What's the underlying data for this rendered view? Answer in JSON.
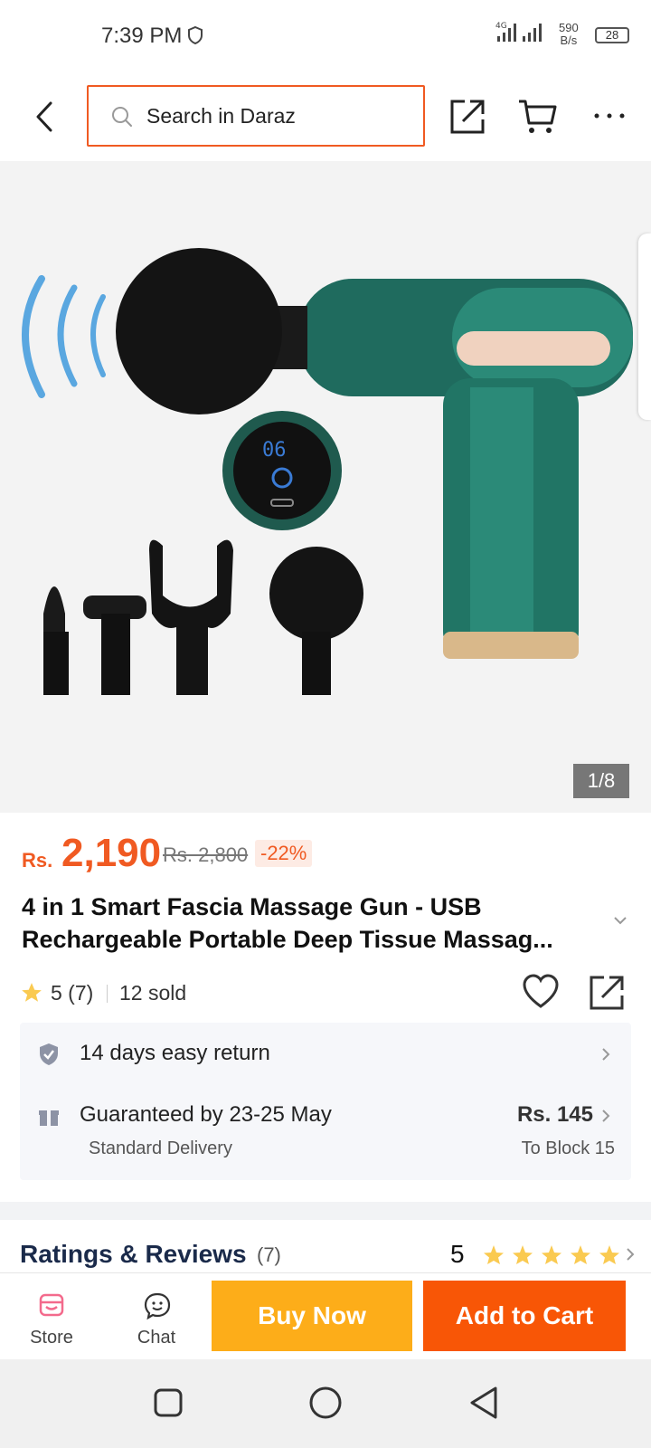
{
  "status_bar": {
    "time": "7:39 PM",
    "network": "4G",
    "speed_value": "590",
    "speed_unit": "B/s",
    "battery": "28"
  },
  "header": {
    "search_placeholder": "Search in Daraz"
  },
  "gallery": {
    "counter": "1/8"
  },
  "product": {
    "currency": "Rs.",
    "price": "2,190",
    "original_price": "Rs. 2,800",
    "discount": "-22%",
    "title": "4 in 1 Smart Fascia Massage Gun - USB Rechargeable Portable Deep Tissue Massag...",
    "rating": "5 (7)",
    "sold": "12 sold"
  },
  "delivery": {
    "return_policy": "14 days easy return",
    "guarantee": "Guaranteed by 23-25 May",
    "method": "Standard Delivery",
    "fee": "Rs. 145",
    "destination": "To Block 15"
  },
  "reviews": {
    "heading": "Ratings & Reviews",
    "count": "(7)",
    "score": "5"
  },
  "bottom_bar": {
    "store_label": "Store",
    "chat_label": "Chat",
    "buy_now_label": "Buy Now",
    "add_to_cart_label": "Add to Cart"
  },
  "colors": {
    "brand_orange": "#f85606",
    "buy_now_yellow": "#fdad19",
    "price_orange": "#f05a22",
    "star_yellow": "#faca51"
  }
}
